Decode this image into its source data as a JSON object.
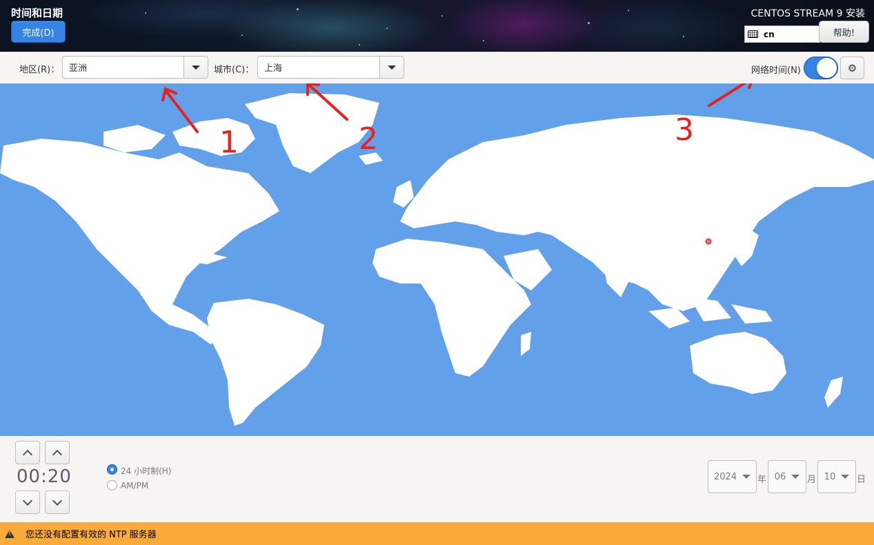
{
  "header": {
    "title": "时间和日期",
    "done_label": "完成(D)",
    "product": "CENTOS STREAM 9 安装",
    "keyboard_layout": "cn",
    "help_label": "帮助!"
  },
  "toolbar": {
    "region_label": "地区(R)：",
    "region_value": "亚洲",
    "city_label": "城市(C)：",
    "city_value": "上海",
    "network_time_label": "网络时间(N)",
    "network_time_on": true
  },
  "annotations": [
    "1",
    "2",
    "3"
  ],
  "clock": {
    "time": "00:20",
    "format_24h_label": "24 小时制(H)",
    "format_ampm_label": "AM/PM",
    "selected_format": "24h"
  },
  "date": {
    "year": "2024",
    "year_unit": "年",
    "month": "06",
    "month_unit": "月",
    "day": "10",
    "day_unit": "日"
  },
  "warning": "您还没有配置有效的 NTP 服务器",
  "colors": {
    "accent": "#3584e4",
    "ocean": "#62a0ea",
    "warning": "#fbab3b",
    "annotation": "#e8201e"
  }
}
